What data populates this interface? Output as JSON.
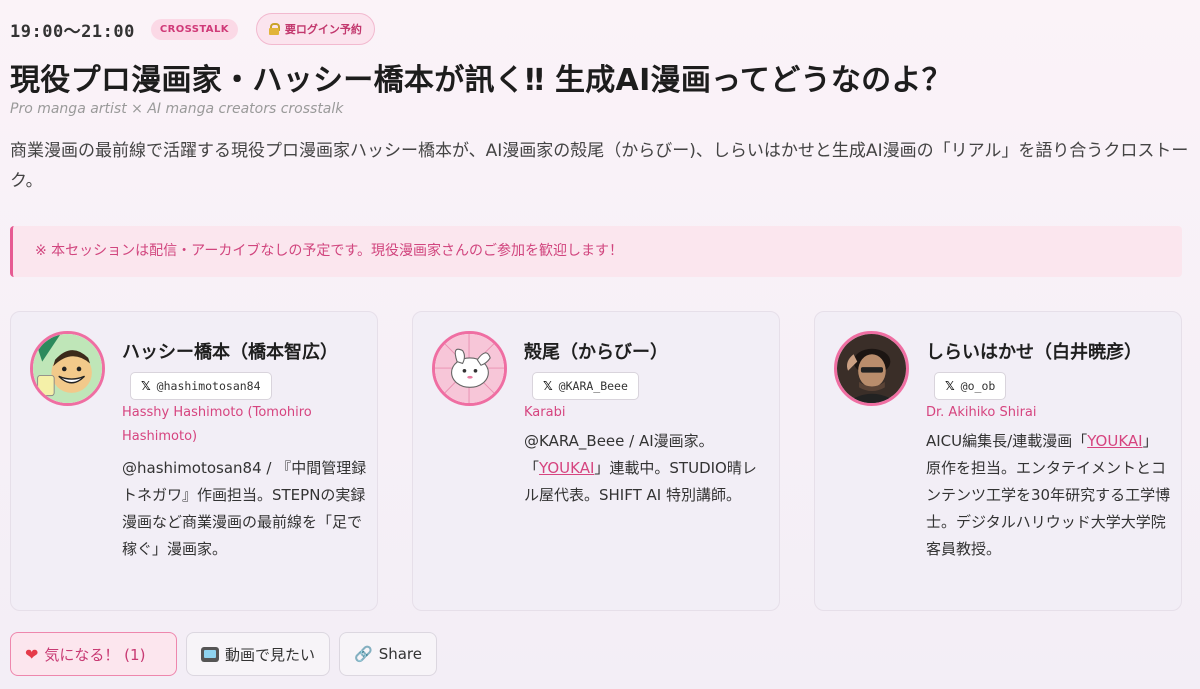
{
  "header": {
    "time": "19:00〜21:00",
    "badge_crosstalk": "CROSSTALK",
    "badge_login": "要ログイン予約",
    "title": "現役プロ漫画家・ハッシー橋本が訊く‼ 生成AI漫画ってどうなのよ？",
    "subtitle": "Pro manga artist × AI manga creators crosstalk",
    "description": "商業漫画の最前線で活躍する現役プロ漫画家ハッシー橋本が、AI漫画家の殻尾（からびー)、しらいはかせと生成AI漫画の「リアル」を語り合うクロストーク。",
    "notice": "※ 本セッションは配信・アーカイブなしの予定です。現役漫画家さんのご参加を歓迎します！"
  },
  "speakers": [
    {
      "name": "ハッシー橋本（橋本智広）",
      "handle": "@hashimotosan84",
      "en_name": "Hasshy Hashimoto (Tomohiro Hashimoto)",
      "bio": "@hashimotosan84 / 『中間管理録トネガワ』作画担当。STEPNの実録漫画など商業漫画の最前線を「足で稼ぐ」漫画家。"
    },
    {
      "name": "殻尾（からびー）",
      "handle": "@KARA_Beee",
      "en_name": "Karabi",
      "bio_pre": "@KARA_Beee / AI漫画家。「",
      "bio_link": "YOUKAI",
      "bio_post": "」連載中。STUDIO晴レル屋代表。SHIFT AI 特別講師。"
    },
    {
      "name": "しらいはかせ（白井暁彦）",
      "handle": "@o_ob",
      "en_name": "Dr. Akihiko Shirai",
      "bio_pre": "AICU編集長/連載漫画「",
      "bio_link": "YOUKAI",
      "bio_post": "」原作を担当。エンタテイメントとコンテンツ工学を30年研究する工学博士。デジタルハリウッド大学大学院客員教授。"
    }
  ],
  "icons": {
    "x": "x-logo-icon",
    "lock": "lock-icon",
    "heart": "heart-icon",
    "tv": "tv-icon",
    "link": "link-icon"
  },
  "colors": {
    "accent": "#d6447f",
    "badge_bg": "#fbd9e6",
    "avatar_border": "#ef6ea2"
  },
  "actions": {
    "like": "気になる！ (1)",
    "video": "動画で見たい",
    "share": "Share"
  }
}
